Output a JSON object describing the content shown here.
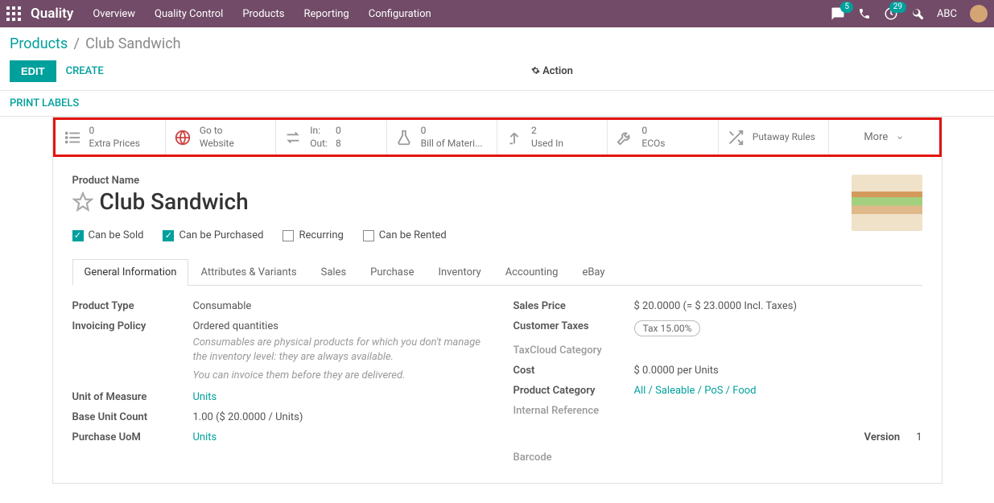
{
  "topbar": {
    "brand": "Quality",
    "nav": [
      "Overview",
      "Quality Control",
      "Products",
      "Reporting",
      "Configuration"
    ],
    "chat_badge": "5",
    "clock_badge": "29",
    "user": "ABC"
  },
  "breadcrumb": {
    "root": "Products",
    "current": "Club Sandwich"
  },
  "actions": {
    "edit": "EDIT",
    "create": "CREATE",
    "action": "Action",
    "print": "PRINT LABELS"
  },
  "stats": {
    "extra_prices": {
      "count": "0",
      "label": "Extra Prices"
    },
    "website": {
      "l1": "Go to",
      "l2": "Website"
    },
    "inout": {
      "in_lbl": "In:",
      "in_val": "0",
      "out_lbl": "Out:",
      "out_val": "8"
    },
    "bom": {
      "count": "0",
      "label": "Bill of Materi..."
    },
    "usedin": {
      "count": "2",
      "label": "Used In"
    },
    "ecos": {
      "count": "0",
      "label": "ECOs"
    },
    "putaway": {
      "label": "Putaway Rules"
    },
    "more": "More"
  },
  "product": {
    "label": "Product Name",
    "name": "Club Sandwich",
    "checks": {
      "sold": {
        "label": "Can be Sold",
        "on": true
      },
      "purchased": {
        "label": "Can be Purchased",
        "on": true
      },
      "recurring": {
        "label": "Recurring",
        "on": false
      },
      "rented": {
        "label": "Can be Rented",
        "on": false
      }
    }
  },
  "tabs": [
    "General Information",
    "Attributes & Variants",
    "Sales",
    "Purchase",
    "Inventory",
    "Accounting",
    "eBay"
  ],
  "left": {
    "type_lbl": "Product Type",
    "type_val": "Consumable",
    "invpol_lbl": "Invoicing Policy",
    "invpol_val": "Ordered quantities",
    "help1": "Consumables are physical products for which you don't manage the inventory level: they are always available.",
    "help2": "You can invoice them before they are delivered.",
    "uom_lbl": "Unit of Measure",
    "uom_val": "Units",
    "base_lbl": "Base Unit Count",
    "base_val": "1.00   ($ 20.0000 / Units)",
    "puom_lbl": "Purchase UoM",
    "puom_val": "Units"
  },
  "right": {
    "price_lbl": "Sales Price",
    "price_val": "$ 20.0000  (= $ 23.0000 Incl. Taxes)",
    "ctax_lbl": "Customer Taxes",
    "ctax_val": "Tax 15.00%",
    "tcloud_lbl": "TaxCloud Category",
    "cost_lbl": "Cost",
    "cost_val": "$ 0.0000 per Units",
    "cat_lbl": "Product Category",
    "cat_val": "All / Saleable / PoS / Food",
    "ref_lbl": "Internal Reference",
    "barcode_lbl": "Barcode",
    "ver_lbl": "Version",
    "ver_val": "1"
  }
}
